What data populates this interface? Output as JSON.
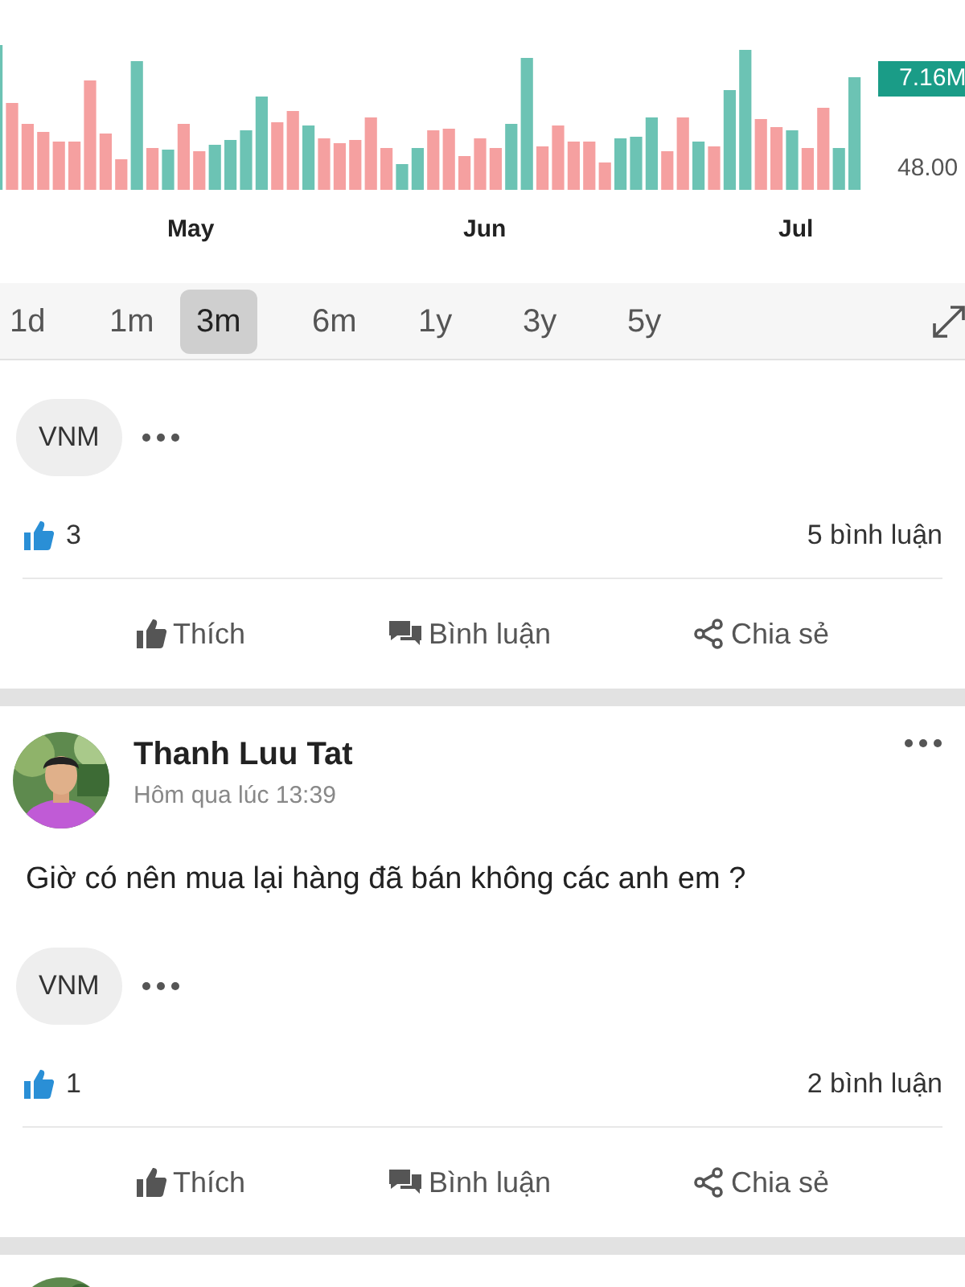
{
  "chart": {
    "volume_badge": "7.16M",
    "price_label": "48.00",
    "months": [
      "May",
      "Jun",
      "Jul"
    ]
  },
  "periods": [
    {
      "label": "1d",
      "selected": false
    },
    {
      "label": "1m",
      "selected": false
    },
    {
      "label": "3m",
      "selected": true
    },
    {
      "label": "6m",
      "selected": false
    },
    {
      "label": "1y",
      "selected": false
    },
    {
      "label": "3y",
      "selected": false
    },
    {
      "label": "5y",
      "selected": false
    }
  ],
  "posts": [
    {
      "tags": [
        "VNM"
      ],
      "likes": "3",
      "comments": "5 bình luận",
      "actions": [
        {
          "kind": "like",
          "label": "Thích"
        },
        {
          "kind": "comment",
          "label": "Bình luận"
        },
        {
          "kind": "share",
          "label": "Chia sẻ"
        }
      ]
    },
    {
      "author": "Thanh Luu Tat",
      "time": "Hôm qua lúc 13:39",
      "text": "Giờ có nên mua lại hàng đã bán không các anh em ?",
      "tags": [
        "VNM"
      ],
      "likes": "1",
      "comments": "2 bình luận",
      "actions": [
        {
          "kind": "like",
          "label": "Thích"
        },
        {
          "kind": "comment",
          "label": "Bình luận"
        },
        {
          "kind": "share",
          "label": "Chia sẻ"
        }
      ]
    }
  ]
}
